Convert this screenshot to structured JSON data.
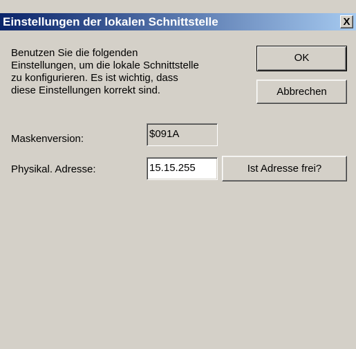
{
  "window": {
    "title": "Einstellungen der lokalen Schnittstelle",
    "close_glyph": "X"
  },
  "intro": {
    "lines": [
      "Benutzen Sie die folgenden",
      "Einstellungen, um die lokale Schnittstelle",
      "zu konfigurieren. Es ist wichtig, dass",
      "diese Einstellungen korrekt sind."
    ]
  },
  "buttons": {
    "ok": "OK",
    "cancel": "Abbrechen",
    "check_address": "Ist Adresse frei?"
  },
  "fields": {
    "mask_version": {
      "label": "Maskenversion:",
      "value": "$091A"
    },
    "physical_address": {
      "label": "Physikal. Adresse:",
      "value": "15.15.255"
    }
  },
  "colors": {
    "titlebar_start": "#0a246a",
    "titlebar_end": "#a6caf0",
    "dialog_face": "#d4d0c8"
  },
  "icons": {
    "close": "close-icon"
  }
}
